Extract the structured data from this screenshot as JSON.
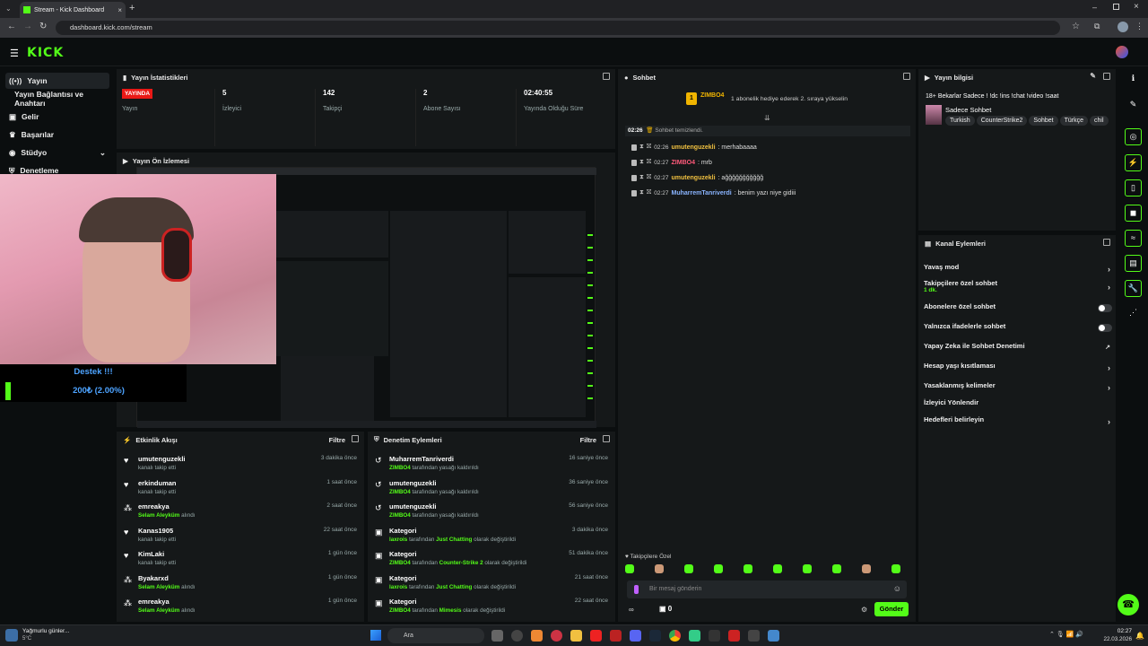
{
  "browser": {
    "tab_title": "Stream - Kick Dashboard",
    "url": "dashboard.kick.com/stream"
  },
  "header": {
    "logo": "KICK"
  },
  "sidebar": {
    "items": [
      {
        "label": "Yayın",
        "icon": "broadcast-icon"
      },
      {
        "label": "Yayın Bağlantısı ve Anahtarı",
        "icon": ""
      },
      {
        "label": "Gelir",
        "icon": "wallet-icon"
      },
      {
        "label": "Başarılar",
        "icon": "trophy-icon"
      },
      {
        "label": "Stüdyo",
        "icon": "studio-icon"
      },
      {
        "label": "Denetleme",
        "icon": "shield-icon"
      }
    ]
  },
  "stats": {
    "title": "Yayın İstatistikleri",
    "live_badge": "YAYINDA",
    "live_label": "Yayın",
    "viewers_value": "5",
    "viewers_label": "İzleyici",
    "followers_value": "142",
    "followers_label": "Takipçi",
    "subs_value": "2",
    "subs_label": "Abone Sayısı",
    "uptime_value": "02:40:55",
    "uptime_label": "Yayında Olduğu Süre"
  },
  "preview": {
    "title": "Yayın Ön İzlemesi"
  },
  "overlay": {
    "support_title": "Destek !!!",
    "support_amount": "200₺ (2.00%)"
  },
  "activity": {
    "title": "Etkinlik Akışı",
    "filter": "Filtre",
    "rows": [
      {
        "name": "umutenguzekli",
        "sub": "kanalı takip etti",
        "highlight": "",
        "time": "3 dakika önce",
        "icon": "heart"
      },
      {
        "name": "erkinduman",
        "sub": "kanalı takip etti",
        "highlight": "",
        "time": "1 saat önce",
        "icon": "heart"
      },
      {
        "name": "emreakya",
        "sub": "alındı",
        "highlight": "Selam Aleyküm",
        "time": "2 saat önce",
        "icon": "reward"
      },
      {
        "name": "Kanas1905",
        "sub": "kanalı takip etti",
        "highlight": "",
        "time": "22 saat önce",
        "icon": "heart"
      },
      {
        "name": "KimLaki",
        "sub": "kanalı takip etti",
        "highlight": "",
        "time": "1 gün önce",
        "icon": "heart"
      },
      {
        "name": "Byakarxd",
        "sub": "alındı",
        "highlight": "Selam Aleyküm",
        "time": "1 gün önce",
        "icon": "reward"
      },
      {
        "name": "emreakya",
        "sub": "alındı",
        "highlight": "Selam Aleyküm",
        "time": "1 gün önce",
        "icon": "reward"
      }
    ]
  },
  "moderation": {
    "title": "Denetim Eylemleri",
    "filter": "Filtre",
    "rows": [
      {
        "name": "MuharremTanriverdi",
        "actor": "ZIMBO4",
        "text": "tarafından yasağı kaldırıldı",
        "text2": "",
        "cat": "",
        "time": "16 saniye önce",
        "icon": "unban"
      },
      {
        "name": "umutenguzekli",
        "actor": "ZIMBO4",
        "text": "tarafından yasağı kaldırıldı",
        "text2": "",
        "cat": "",
        "time": "36 saniye önce",
        "icon": "unban"
      },
      {
        "name": "umutenguzekli",
        "actor": "ZIMBO4",
        "text": "tarafından yasağı kaldırıldı",
        "text2": "",
        "cat": "",
        "time": "56 saniye önce",
        "icon": "unban"
      },
      {
        "name": "Kategori",
        "actor": "laxrois",
        "text": "tarafından",
        "cat": "Just Chatting",
        "text2": "olarak değiştirildi",
        "time": "3 dakika önce",
        "icon": "category"
      },
      {
        "name": "Kategori",
        "actor": "ZIMBO4",
        "text": "tarafından",
        "cat": "Counter-Strike 2",
        "text2": "olarak değiştirildi",
        "time": "51 dakika önce",
        "icon": "category"
      },
      {
        "name": "Kategori",
        "actor": "laxrois",
        "text": "tarafından",
        "cat": "Just Chatting",
        "text2": "olarak değiştirildi",
        "time": "21 saat önce",
        "icon": "category"
      },
      {
        "name": "Kategori",
        "actor": "ZIMBO4",
        "text": "tarafından",
        "cat": "Mimesis",
        "text2": "olarak değiştirildi",
        "time": "22 saat önce",
        "icon": "category"
      }
    ]
  },
  "chat": {
    "title": "Sohbet",
    "pinned_user": "ZIMBO4",
    "pinned_count": "1",
    "pinned_msg": "1 abonelik hediye ederek 2. sıraya yükselin",
    "cleared_time": "02:26",
    "cleared_text": "Sohbet temizlendi.",
    "messages": [
      {
        "time": "02:26",
        "user": "umutenguzekli",
        "text": ": merhabaaaa",
        "color": "#f0c040"
      },
      {
        "time": "02:27",
        "user": "ZIMBO4",
        "text": ": mrb",
        "color": "#ff5a7a"
      },
      {
        "time": "02:27",
        "user": "umutenguzekli",
        "text": ": ağğğğğğğğğğğ",
        "color": "#f0c040"
      },
      {
        "time": "02:27",
        "user": "MuharremTanriverdi",
        "text": ": benim yazı niye gidiii",
        "color": "#8ab4ff"
      }
    ],
    "followers_only": "Takipçilere Özel",
    "input_placeholder": "Bir mesaj gönderin",
    "points": "0",
    "send": "Gönder"
  },
  "stream_info": {
    "title": "Yayın bilgisi",
    "stream_title": "18+ Bekarlar Sadece ! !dc !ins !chat !video !saat",
    "category": "Sadece Sohbet",
    "tags": [
      "Turkish",
      "CounterStrike2",
      "Sohbet",
      "Türkçe",
      "chil"
    ]
  },
  "channel_actions": {
    "title": "Kanal Eylemleri",
    "slow_mode": "Yavaş mod",
    "followers_chat": "Takipçilere özel sohbet",
    "followers_chat_sub": "1 dk.",
    "subs_chat": "Abonelere özel sohbet",
    "emote_chat": "Yalnızca ifadelerle sohbet",
    "ai_mod": "Yapay Zeka ile Sohbet Denetimi",
    "account_age": "Hesap yaşı kısıtlaması",
    "banned_words": "Yasaklanmış kelimeler",
    "raid": "İzleyici Yönlendir",
    "goals": "Hedefleri belirleyin"
  },
  "taskbar": {
    "weather": "Yağmurlu günler...",
    "temp": "5°C",
    "search": "Ara",
    "time": "02:27",
    "date": "22.03.2026"
  },
  "colors": {
    "accent": "#53fc18",
    "live": "#e91916",
    "panel": "#151819",
    "bg": "#0b0e0f"
  }
}
